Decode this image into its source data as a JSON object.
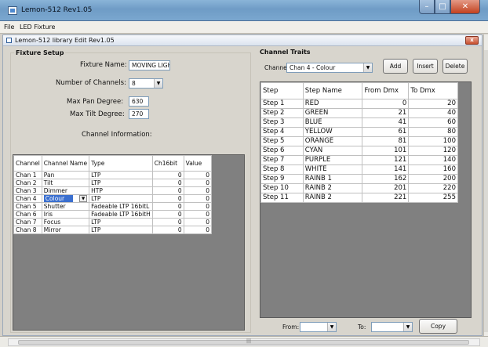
{
  "window": {
    "title": "Lemon-512 Rev1.05",
    "min": "–",
    "max": "□",
    "close": "✕"
  },
  "menu": {
    "file": "File",
    "led": "LED Fixture"
  },
  "child": {
    "title": "Lemon-512 library Edit Rev1.05",
    "close": "x"
  },
  "setup": {
    "title": "Fixture Setup",
    "name_label": "Fixture Name:",
    "name_value": "MOVING LIGH",
    "channels_label": "Number of Channels:",
    "channels_value": "8",
    "pan_label": "Max Pan Degree:",
    "pan_value": "630",
    "tilt_label": "Max Tilt Degree:",
    "tilt_value": "270",
    "info_label": "Channel Information:",
    "headers": [
      "Channel",
      "Channel Name",
      "Type",
      "Ch16bit",
      "Value"
    ],
    "rows": [
      [
        "Chan 1",
        "Pan",
        "LTP",
        "0",
        "0"
      ],
      [
        "Chan 2",
        "Tilt",
        "LTP",
        "0",
        "0"
      ],
      [
        "Chan 3",
        "Dimmer",
        "HTP",
        "0",
        "0"
      ],
      [
        "Chan 4",
        "Colour",
        "LTP",
        "0",
        "0"
      ],
      [
        "Chan 5",
        "Shutter",
        "Fadeable LTP 16bitL",
        "0",
        "0"
      ],
      [
        "Chan 6",
        "Iris",
        "Fadeable LTP 16bitH",
        "0",
        "0"
      ],
      [
        "Chan 7",
        "Focus",
        "LTP",
        "0",
        "0"
      ],
      [
        "Chan 8",
        "Mirror",
        "LTP",
        "0",
        "0"
      ]
    ]
  },
  "traits": {
    "title": "Channel Traits",
    "channel_label": "Channel:",
    "channel_value": "Chan 4 - Colour",
    "add": "Add",
    "insert": "Insert",
    "delete": "Delete",
    "headers": [
      "Step",
      "Step Name",
      "From Dmx",
      "To Dmx"
    ],
    "rows": [
      [
        "Step 1",
        "RED",
        "0",
        "20"
      ],
      [
        "Step 2",
        "GREEN",
        "21",
        "40"
      ],
      [
        "Step 3",
        "BLUE",
        "41",
        "60"
      ],
      [
        "Step 4",
        "YELLOW",
        "61",
        "80"
      ],
      [
        "Step 5",
        "ORANGE",
        "81",
        "100"
      ],
      [
        "Step 6",
        "CYAN",
        "101",
        "120"
      ],
      [
        "Step 7",
        "PURPLE",
        "121",
        "140"
      ],
      [
        "Step 8",
        "WHITE",
        "141",
        "160"
      ],
      [
        "Step 9",
        "RAINB 1",
        "162",
        "200"
      ],
      [
        "Step 10",
        "RAINB 2",
        "201",
        "220"
      ],
      [
        "Step 11",
        "RAINB 2",
        "221",
        "255"
      ]
    ],
    "from_label": "From:",
    "to_label": "To:",
    "copy": "Copy"
  },
  "status": {
    "text": "|||"
  }
}
